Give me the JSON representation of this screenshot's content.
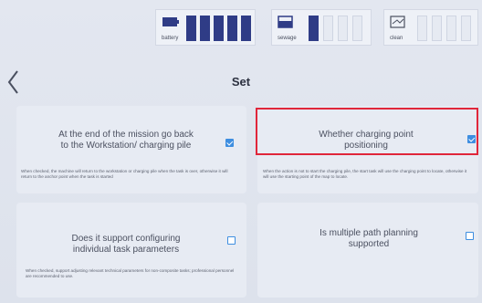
{
  "status": {
    "battery": {
      "label": "battery",
      "level": 1.0,
      "segments": 5
    },
    "sewage": {
      "label": "sewage",
      "level": 0.25,
      "segments": 4
    },
    "clean": {
      "label": "clean",
      "level": 0.0,
      "segments": 4
    }
  },
  "header": {
    "title": "Set",
    "back_icon": "chevron-left-icon"
  },
  "settings": [
    {
      "title": "At the end of the mission go back to the Workstation/ charging pile",
      "description": "When checked, the machine will return to the workstation or charging pile when the task is over, otherwise it will return to the anchor point when the task is started",
      "checked": true
    },
    {
      "title": "Whether charging point positioning",
      "description": "When the action is not to start the charging pile, the start task will use the charging point to locate, otherwise it will use the starting point of the map to locate.",
      "checked": true
    },
    {
      "title": "Does it support configuring individual task parameters",
      "description": "When checked, support adjusting relevant technical parameters for non-composite tasks; professional personnel are recommended to use.",
      "checked": false
    },
    {
      "title": "Is multiple path planning supported",
      "description": "",
      "checked": false
    }
  ],
  "colors": {
    "accent": "#3e8ee0",
    "gauge_fill": "#2f3c86",
    "highlight": "#e0263a"
  }
}
